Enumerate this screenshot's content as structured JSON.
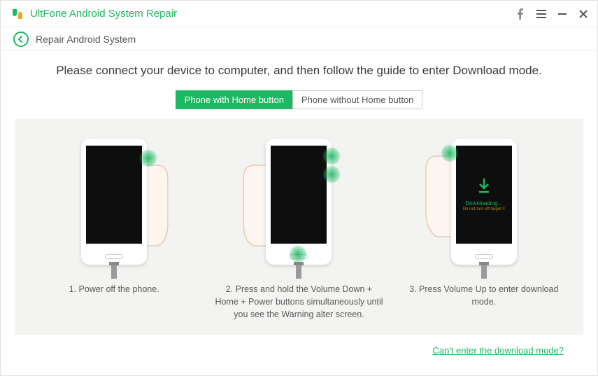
{
  "titlebar": {
    "app_name": "UltFone Android System Repair"
  },
  "breadcrumb": {
    "label": "Repair Android System"
  },
  "main": {
    "instruction": "Please connect your device to computer, and then follow the guide to enter Download mode.",
    "tabs": {
      "with_home": "Phone with Home button",
      "without_home": "Phone without Home button",
      "active_index": 0
    },
    "steps": [
      {
        "caption": "1. Power off the phone."
      },
      {
        "caption": "2. Press and hold the Volume Down + Home + Power buttons simultaneously until you see the Warning alter screen."
      },
      {
        "caption": "3. Press Volume Up to enter download mode."
      }
    ],
    "download_screen": {
      "status": "Downloading...",
      "warning": "Do not turn off target !!"
    }
  },
  "footer": {
    "help_link": "Can't enter the download mode?"
  }
}
